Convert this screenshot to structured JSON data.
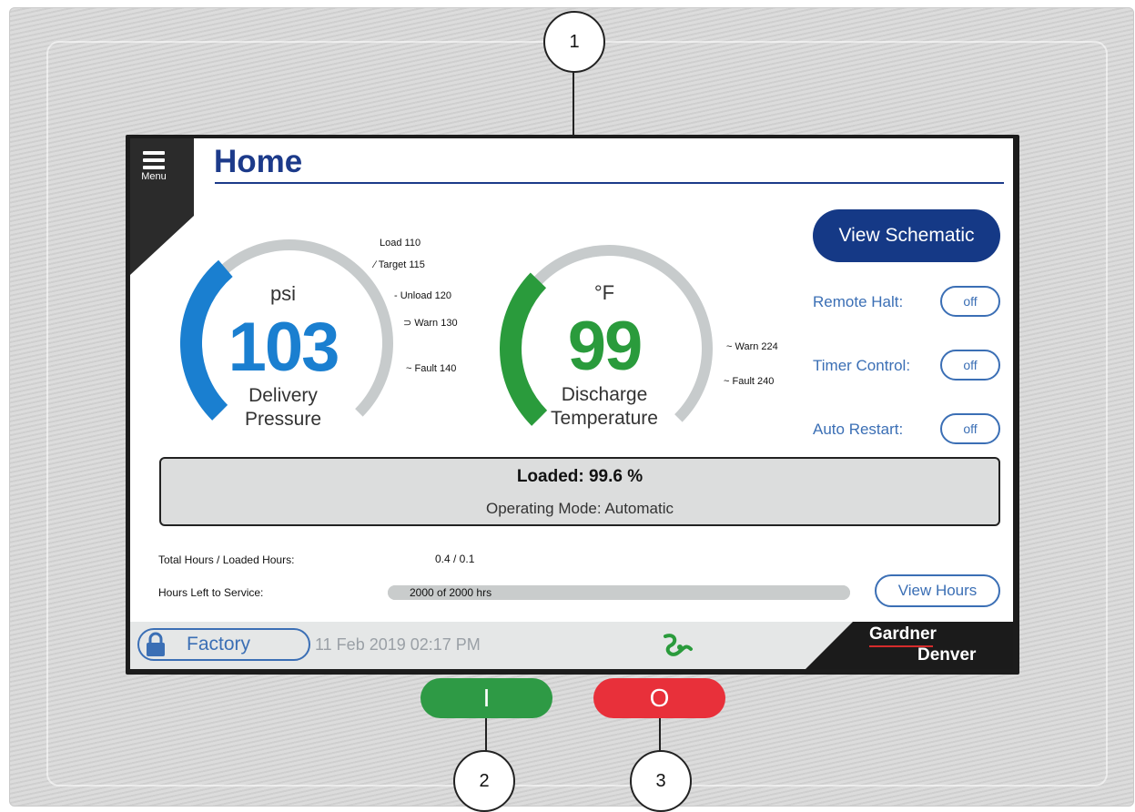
{
  "callouts": [
    "1",
    "2",
    "3"
  ],
  "menu": {
    "label": "Menu",
    "icon": "hamburger-icon"
  },
  "page": {
    "title": "Home"
  },
  "pressure_gauge": {
    "unit": "psi",
    "value": "103",
    "label_line1": "Delivery",
    "label_line2": "Pressure",
    "fill_fraction": 0.35,
    "color": "#1a7fd0",
    "markers": [
      "Load 110",
      "Target 115",
      "Unload 120",
      "Warn 130",
      "Fault 140"
    ]
  },
  "temperature_gauge": {
    "unit": "°F",
    "value": "99",
    "label_line1": "Discharge",
    "label_line2": "Temperature",
    "fill_fraction": 0.33,
    "color": "#2a9b3c",
    "markers": [
      "Warn 224",
      "Fault 240"
    ]
  },
  "controls": {
    "view_schematic": "View Schematic",
    "remote_halt": {
      "label": "Remote Halt:",
      "value": "off"
    },
    "timer_control": {
      "label": "Timer Control:",
      "value": "off"
    },
    "auto_restart": {
      "label": "Auto Restart:",
      "value": "off"
    }
  },
  "status": {
    "loaded": "Loaded: 99.6 %",
    "mode": "Operating Mode: Automatic"
  },
  "hours": {
    "total_label": "Total Hours / Loaded Hours:",
    "total_value": "0.4 / 0.1",
    "service_label": "Hours Left to Service:",
    "service_value": "2000 of 2000 hrs",
    "service_fraction": 1.0,
    "view_hours": "View Hours"
  },
  "footer": {
    "access_level": "Factory",
    "datetime": "11 Feb 2019 02:17 PM",
    "status_icon": "compressor-running-icon",
    "brand_line1": "Gardner",
    "brand_line2": "Denver"
  },
  "hardware_buttons": {
    "start_symbol": "I",
    "stop_symbol": "O",
    "start_color": "#2e9a45",
    "stop_color": "#e8303a"
  },
  "colors": {
    "accent": "#153986",
    "link": "#3b6fb5",
    "pressure": "#1a7fd0",
    "temperature": "#2a9b3c",
    "track": "#c7cbcc"
  }
}
